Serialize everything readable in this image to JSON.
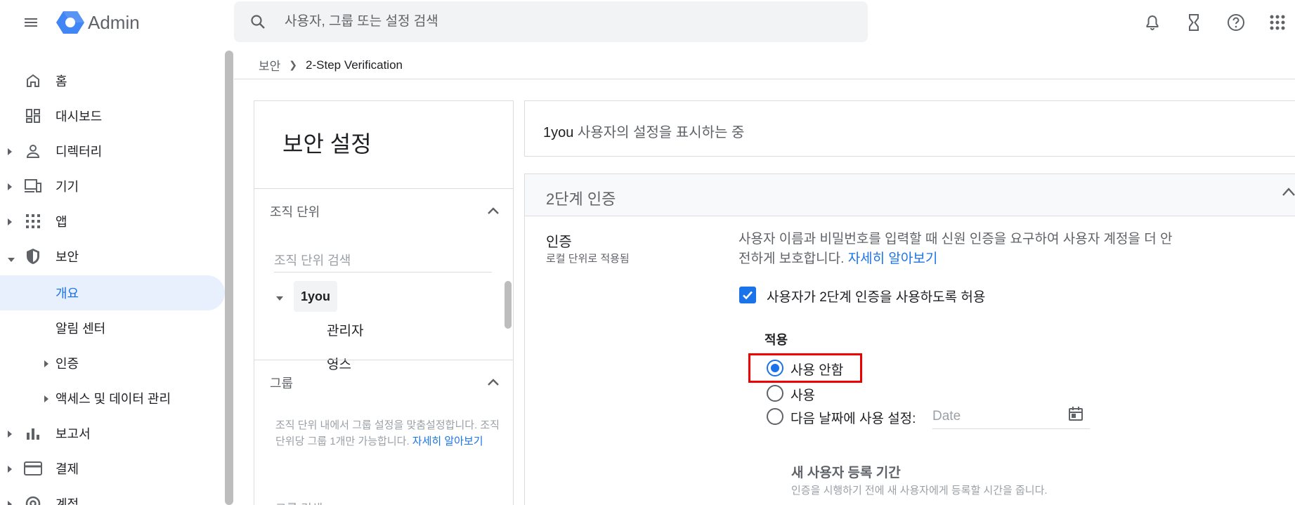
{
  "header": {
    "brand": "Admin",
    "search_placeholder": "사용자, 그룹 또는 설정 검색"
  },
  "sidebar": {
    "items": [
      {
        "label": "홈",
        "icon": "home-icon"
      },
      {
        "label": "대시보드",
        "icon": "dashboard-icon"
      },
      {
        "label": "디렉터리",
        "icon": "person-icon"
      },
      {
        "label": "기기",
        "icon": "devices-icon"
      },
      {
        "label": "앱",
        "icon": "apps-grid-icon"
      },
      {
        "label": "보안",
        "icon": "shield-icon"
      },
      {
        "label": "개요"
      },
      {
        "label": "알림 센터"
      },
      {
        "label": "인증"
      },
      {
        "label": "액세스 및 데이터 관리"
      },
      {
        "label": "보고서",
        "icon": "bar-chart-icon"
      },
      {
        "label": "결제",
        "icon": "credit-card-icon"
      },
      {
        "label": "계정",
        "icon": "account-icon"
      }
    ]
  },
  "breadcrumb": {
    "parent": "보안",
    "current": "2-Step Verification"
  },
  "left_panel": {
    "title": "보안 설정",
    "org_section": "조직 단위",
    "org_search_placeholder": "조직 단위 검색",
    "tree": {
      "root": "1you",
      "children": [
        "관리자",
        "영스"
      ]
    },
    "group_section": "그룹",
    "group_desc": "조직 단위 내에서 그룹 설정을 맞춤설정합니다. 조직 단위당 그룹 1개만 가능합니다.",
    "group_link": "자세히 알아보기",
    "group_search": "그룹 검색"
  },
  "info": {
    "org": "1you",
    "text": " 사용자의 설정을 표시하는 중"
  },
  "settings": {
    "title": "2단계 인증",
    "category": "인증",
    "category_sub": "로컬 단위로 적용됨",
    "description": "사용자 이름과 비밀번호를 입력할 때 신원 인증을 요구하여 사용자 계정을 더 안전하게 보호합니다. ",
    "learn_more": "자세히 알아보기",
    "allow_label": "사용자가 2단계 인증을 사용하도록 허용",
    "allow_checked": true,
    "enforce_label": "적용",
    "options": [
      "사용 안함",
      "사용",
      "다음 날짜에 사용 설정:"
    ],
    "selected_option": "사용 안함",
    "date_placeholder": "Date",
    "enroll_title": "새 사용자 등록 기간",
    "enroll_desc": "인증을 시행하기 전에 새 사용자에게 등록할 시간을 줍니다."
  },
  "colors": {
    "accent": "#1a73e8",
    "active_bg": "#e8f0fe",
    "highlight": "#ee0000"
  }
}
